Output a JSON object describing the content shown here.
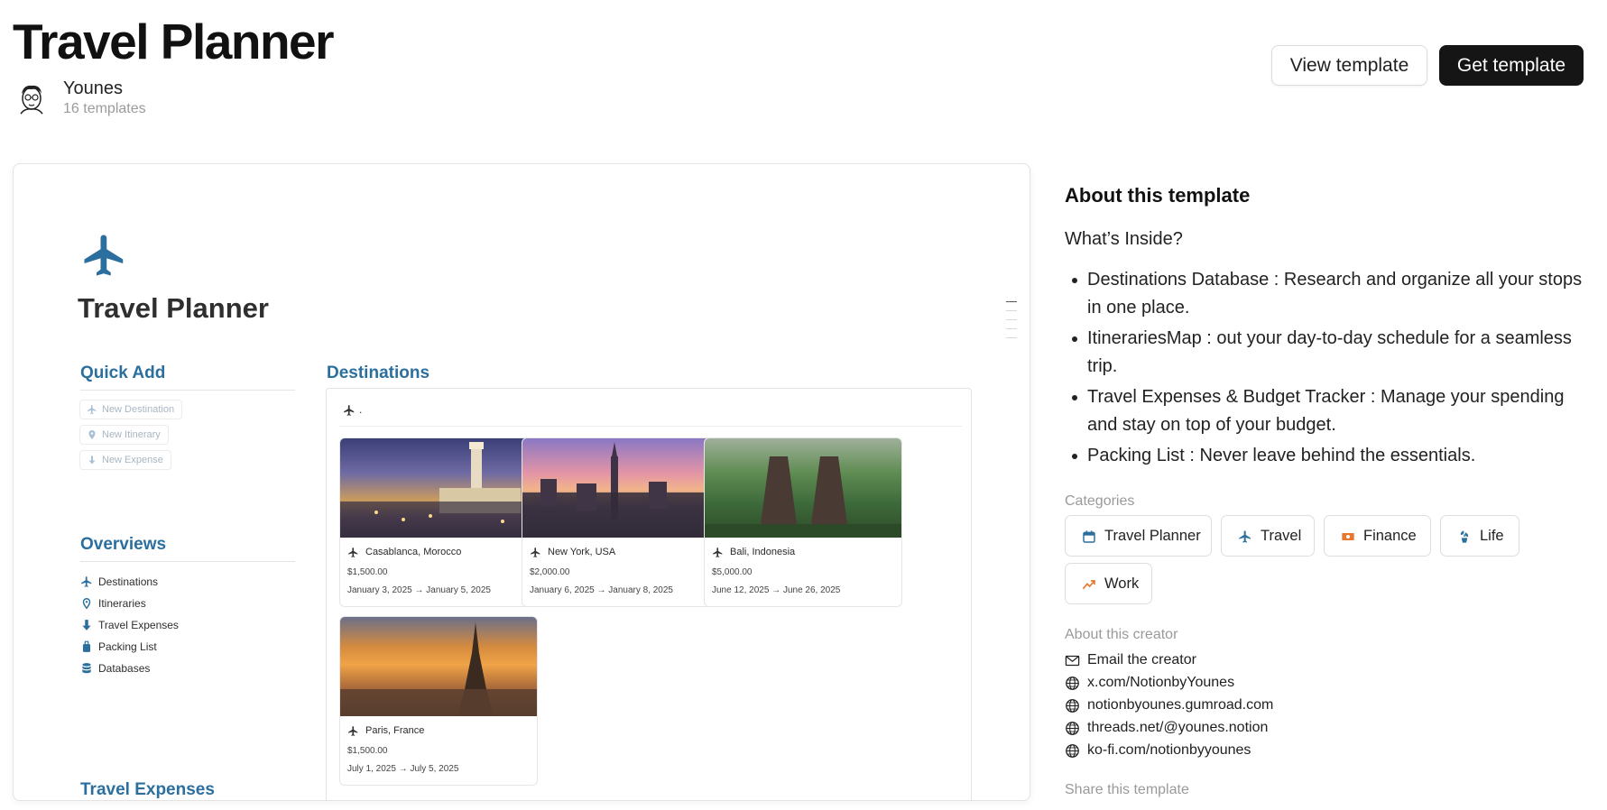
{
  "header": {
    "title": "Travel Planner",
    "author_name": "Younes",
    "author_templates": "16 templates",
    "view_button": "View template",
    "get_button": "Get template"
  },
  "preview": {
    "doc_title": "Travel Planner",
    "quick_add": {
      "heading": "Quick Add",
      "buttons": [
        "New Destination",
        "New Itinerary",
        "New Expense"
      ]
    },
    "overviews": {
      "heading": "Overviews",
      "items": [
        "Destinations",
        "Itineraries",
        "Travel Expenses",
        "Packing List",
        "Databases"
      ]
    },
    "travel_expenses_heading": "Travel Expenses",
    "destinations": {
      "heading": "Destinations",
      "view_label": ".",
      "cards": [
        {
          "name": "Casablanca, Morocco",
          "price": "$1,500.00",
          "dates": "January 3, 2025 → January 5, 2025"
        },
        {
          "name": "New York, USA",
          "price": "$2,000.00",
          "dates": "January 6, 2025 → January 8, 2025"
        },
        {
          "name": "Bali, Indonesia",
          "price": "$5,000.00",
          "dates": "June 12, 2025 → June 26, 2025"
        },
        {
          "name": "Paris, France",
          "price": "$1,500.00",
          "dates": "July 1, 2025 → July 5, 2025"
        }
      ]
    }
  },
  "sidebar": {
    "about_heading": "About this template",
    "whats_inside": "What’s Inside?",
    "bullets": [
      "Destinations Database : Research and organize all your stops in one place.",
      "ItinerariesMap : out your day-to-day schedule for a seamless trip.",
      "Travel Expenses & Budget Tracker : Manage your spending and stay on top of your budget.",
      "Packing List : Never leave behind the essentials."
    ],
    "categories_label": "Categories",
    "categories": [
      "Travel Planner",
      "Travel",
      "Finance",
      "Life",
      "Work"
    ],
    "creator_label": "About this creator",
    "creator_links": [
      "Email the creator",
      "x.com/NotionbyYounes",
      "notionbyounes.gumroad.com",
      "threads.net/@younes.notion",
      "ko-fi.com/notionbyyounes"
    ],
    "share_label": "Share this template"
  },
  "colors": {
    "accent_blue": "#2b6f9e",
    "button_dark": "#151515",
    "finance_orange": "#e8772e"
  }
}
